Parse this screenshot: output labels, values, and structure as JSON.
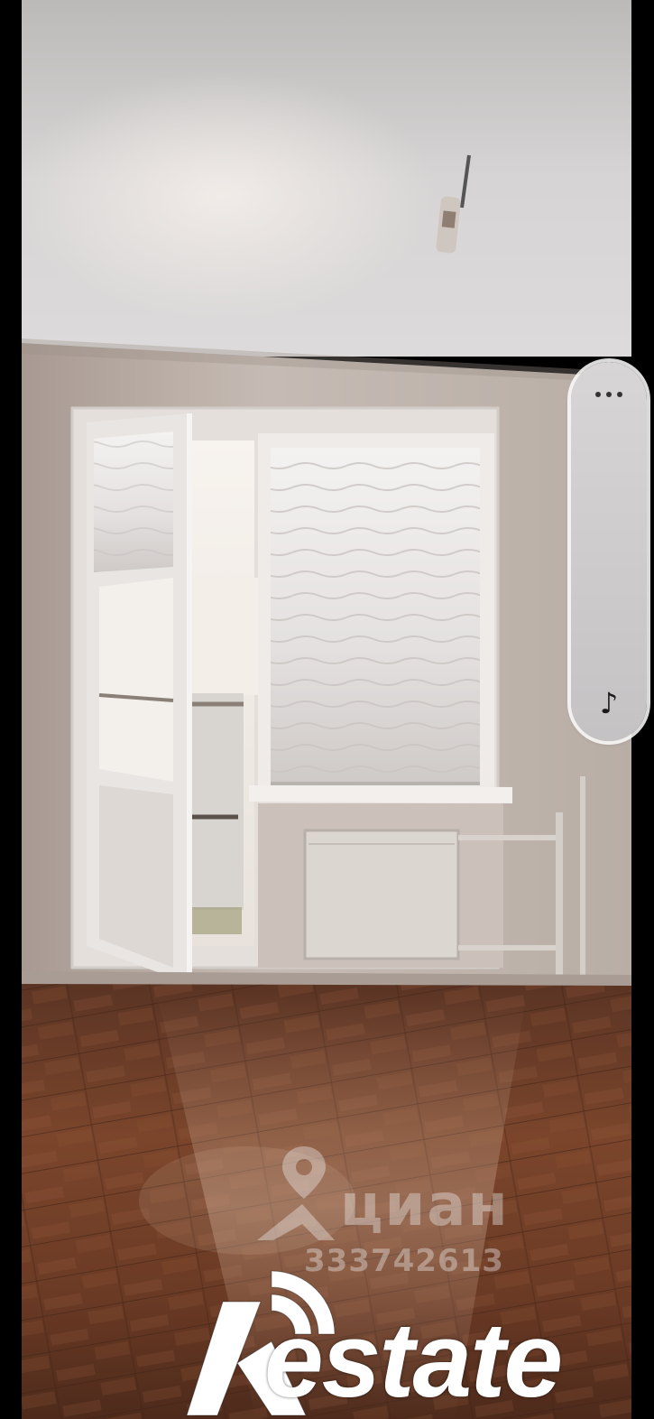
{
  "viewer": {
    "side_controls": {
      "more_icon": "ellipsis-icon",
      "music_icon": "music-note-icon",
      "music_glyph": "♪"
    }
  },
  "watermark": {
    "brand": "циан",
    "listing_id": "333742613",
    "icon": "location-pin-icon"
  },
  "logo": {
    "text": "estate",
    "mark": "R-signal-logo"
  },
  "photo": {
    "subject": "room-interior",
    "colors": {
      "ceiling": "#d8d6d6",
      "walls": "#bdb2aa",
      "floor": "#6a3a22",
      "window_frame": "#ece9e6"
    }
  }
}
